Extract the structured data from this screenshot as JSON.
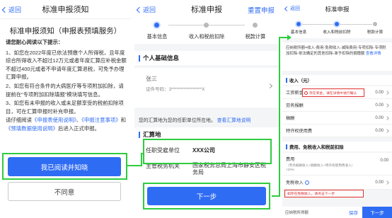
{
  "screen1": {
    "back_label": "返回",
    "nav_title": "标准申报须知",
    "heading": "标准申报须知（申报表预填服务）",
    "intro": "请您耐心阅读以下提示：",
    "p1": "1、如您在2022年度已依法预缴个人所得税，且年度综合所得收入不超过12万元或者年度汇算应补税金额不超过400元或者不申请年度汇算退税，可免予办理汇算申报。",
    "p2": "2、如您有符合条件的大病医疗等专项附加扣除，请提前在“专项附加扣除填报”模块填写信息。",
    "p3": "3、如您有未申报的收入或未足额享受的税前扣除项目，可在汇算申报时补充申报。",
    "p4_prefix": "请仔细阅读",
    "p4_link1": "《申报表使用说明》",
    "p4_sep": "、",
    "p4_link2": "《申报注意事项》",
    "p4_mid": "和",
    "p4_link3": "《预填数据使用说明》",
    "p4_suffix": "后进入正式申报。",
    "agree_button": "我已阅读并知晓",
    "disagree_button": "不同意"
  },
  "screen2": {
    "back_label": "返回",
    "nav_title": "标准申报",
    "reset_button": "重置申报",
    "steps": [
      "基本信息",
      "收入和税前扣除",
      "税款计算"
    ],
    "personal_section_title": "个人基础信息",
    "person_name": "张三",
    "id_label": "证件号码：",
    "id_value": "3*****************X",
    "notice_text": "您的汇算地为您的任职单位所在地。",
    "notice_link": "查看汇算地说明",
    "place_section_title": "汇算地",
    "employer_label": "任职受雇单位",
    "employer_value": "XXX公司",
    "tax_office_label": "主管税务机关",
    "tax_office_value": "国家税务总局上海市静安区税务局",
    "next_button": "下一步"
  },
  "screen3": {
    "back_label": "返回",
    "nav_title": "标准申报",
    "steps": [
      "基本信息",
      "收入和税前扣除",
      "税款计算"
    ],
    "desc_a": "应纳税所额=收入-费用-免税收入-减除费用-专项扣除-专项附加扣除-依法确定的其他扣除-准予扣除的捐赠额",
    "desc_link": "查看详情",
    "income_section": "收入（元）",
    "income_rows": [
      {
        "label": "工资薪金",
        "value": "0.00"
      },
      {
        "label": "劳务报酬",
        "value": "0.00"
      },
      {
        "label": "稿酬",
        "value": "0.00"
      },
      {
        "label": "特许权使用费",
        "value": "0.00"
      }
    ],
    "warning_text": "存在奖金，请在详情中进行确认",
    "deduct_section": "费用、免税收入和税前扣除",
    "fee_label": "费用",
    "fee_value": "0.00",
    "fee_note": "（劳务报酬收入+稿酬收入+特许权使用费收入）×20%",
    "exempt_label": "免税收入",
    "exempt_value": "0.00",
    "exempt_warning": "如存在免税收入，请点击下一步",
    "bottom_label": "应纳税所得额",
    "save_button": "保存",
    "next_button": "下一步"
  }
}
